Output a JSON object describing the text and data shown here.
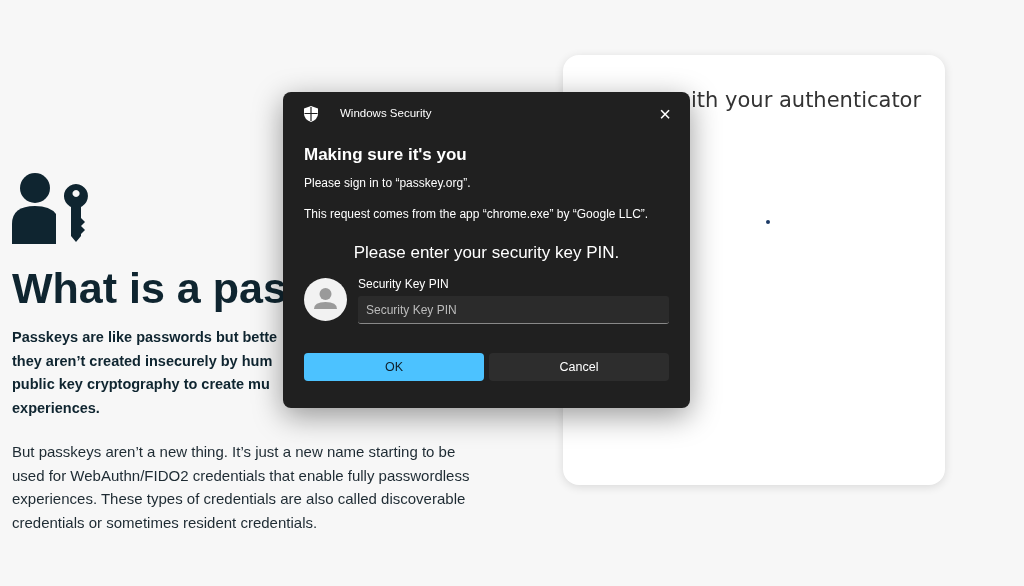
{
  "article": {
    "heading": "What is a pas",
    "intro_lines": [
      "Passkeys are like passwords but bette",
      "they aren’t created insecurely by hum",
      "public key cryptography to create mu",
      "experiences."
    ],
    "paragraph": "But passkeys aren’t a new thing. It’s just a new name starting to be used for WebAuthn/FIDO2 credentials that enable fully passwordless experiences. These types of credentials are also called discoverable credentials or sometimes resident credentials."
  },
  "card": {
    "title": "ith your authenticator"
  },
  "dialog": {
    "app_title": "Windows Security",
    "close": "×",
    "heading": "Making sure it's you",
    "lines": [
      "Please sign in to “passkey.org”.",
      "This request comes from the app “chrome.exe” by “Google LLC”."
    ],
    "prompt": "Please enter your security key PIN.",
    "field": {
      "label": "Security Key PIN",
      "placeholder": "Security Key PIN"
    },
    "buttons": [
      {
        "label": "OK",
        "kind": "primary"
      },
      {
        "label": "Cancel",
        "kind": "secondary"
      }
    ]
  }
}
